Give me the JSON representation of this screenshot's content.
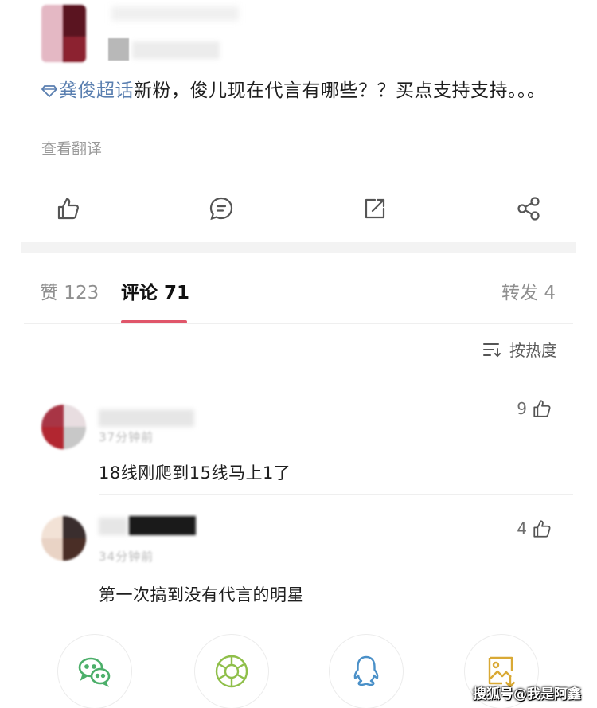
{
  "post": {
    "topic": "龚俊超话",
    "text_after_topic": "新粉，俊儿现在代言有哪些？？买点支持支持。。。",
    "translate_label": "查看翻译"
  },
  "actions": {
    "like_icon": "thumbs-up-icon",
    "comment_icon": "comment-icon",
    "repost_icon": "repost-icon",
    "share_icon": "share-icon"
  },
  "tabs": {
    "likes": "赞 123",
    "comments": "评论 71",
    "reposts": "转发 4"
  },
  "sort": {
    "label": "按热度"
  },
  "comments": [
    {
      "time_blurred": "37分钟前",
      "text": "18线刚爬到15线马上1了",
      "likes": "9"
    },
    {
      "time_blurred": "34分钟前",
      "text": "第一次搞到没有代言的明星",
      "likes": "4"
    }
  ],
  "share": {
    "wechat_icon": "wechat-icon",
    "moments_icon": "moments-icon",
    "qq_icon": "qq-icon",
    "save_icon": "save-image-icon"
  },
  "watermark": "搜狐号@我是阿鑫",
  "colors": {
    "accent": "#e0566a",
    "topic": "#5a7fb0",
    "muted": "#9a9a9a"
  }
}
